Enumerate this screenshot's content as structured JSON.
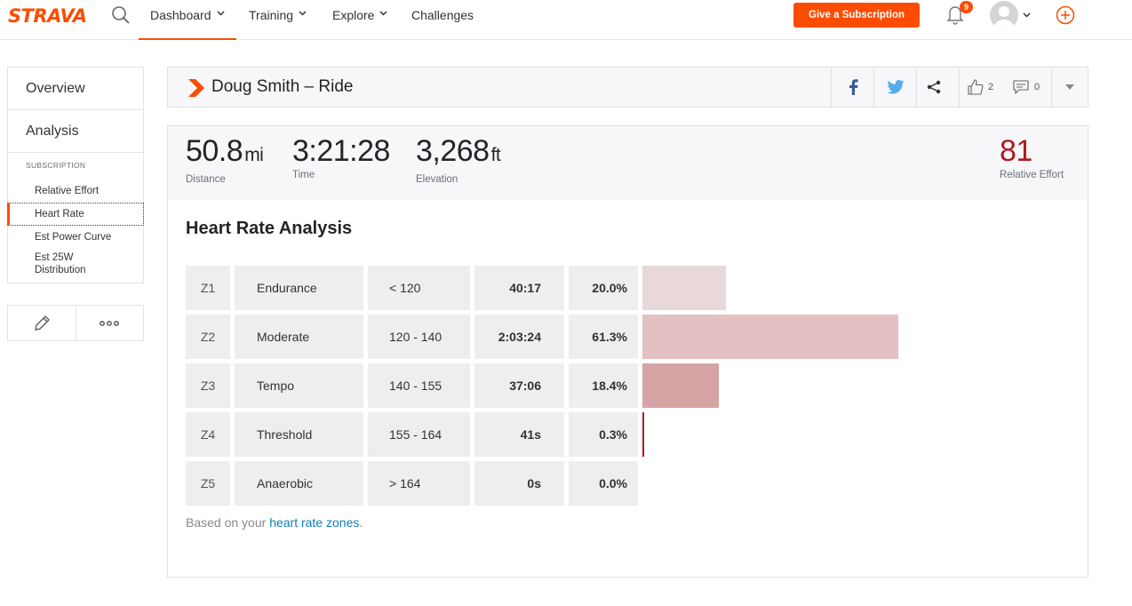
{
  "nav": {
    "logo": "STRAVA",
    "items": [
      {
        "label": "Dashboard"
      },
      {
        "label": "Training"
      },
      {
        "label": "Explore"
      },
      {
        "label": "Challenges"
      }
    ],
    "subscribe_label": "Give a Subscription",
    "notification_count": "9",
    "brand_color": "#fc4c02"
  },
  "sidebar": {
    "tabs": [
      "Overview",
      "Analysis"
    ],
    "section": "SUBSCRIPTION",
    "links": [
      "Relative Effort",
      "Heart Rate",
      "Est Power Curve",
      "Est 25W Distribution"
    ],
    "active_link": "Heart Rate"
  },
  "activity": {
    "title": "Doug Smith – Ride",
    "kudos_count": "2",
    "comment_count": "0"
  },
  "stats": [
    {
      "value": "50.8",
      "unit": "mi",
      "label": "Distance"
    },
    {
      "value": "3:21:28",
      "unit": "",
      "label": "Time"
    },
    {
      "value": "3,268",
      "unit": "ft",
      "label": "Elevation"
    }
  ],
  "relative_effort": {
    "value": "81",
    "label": "Relative Effort",
    "color": "#b0171f"
  },
  "hr_analysis": {
    "title": "Heart Rate Analysis",
    "zones": [
      {
        "id": "Z1",
        "name": "Endurance",
        "range": "< 120",
        "time": "40:17",
        "pct_label": "20.0%",
        "pct": 20.0,
        "color": "#e8d8d9"
      },
      {
        "id": "Z2",
        "name": "Moderate",
        "range": "120 - 140",
        "time": "2:03:24",
        "pct_label": "61.3%",
        "pct": 61.3,
        "color": "#e3c1c2"
      },
      {
        "id": "Z3",
        "name": "Tempo",
        "range": "140 - 155",
        "time": "37:06",
        "pct_label": "18.4%",
        "pct": 18.4,
        "color": "#d6a4a5"
      },
      {
        "id": "Z4",
        "name": "Threshold",
        "range": "155 - 164",
        "time": "41s",
        "pct_label": "0.3%",
        "pct": 0.3,
        "color": "#b0171f"
      },
      {
        "id": "Z5",
        "name": "Anaerobic",
        "range": "> 164",
        "time": "0s",
        "pct_label": "0.0%",
        "pct": 0.0,
        "color": "#8a0f17"
      }
    ],
    "footnote_prefix": "Based on your",
    "footnote_link": "heart rate zones",
    "footnote_suffix": "."
  }
}
